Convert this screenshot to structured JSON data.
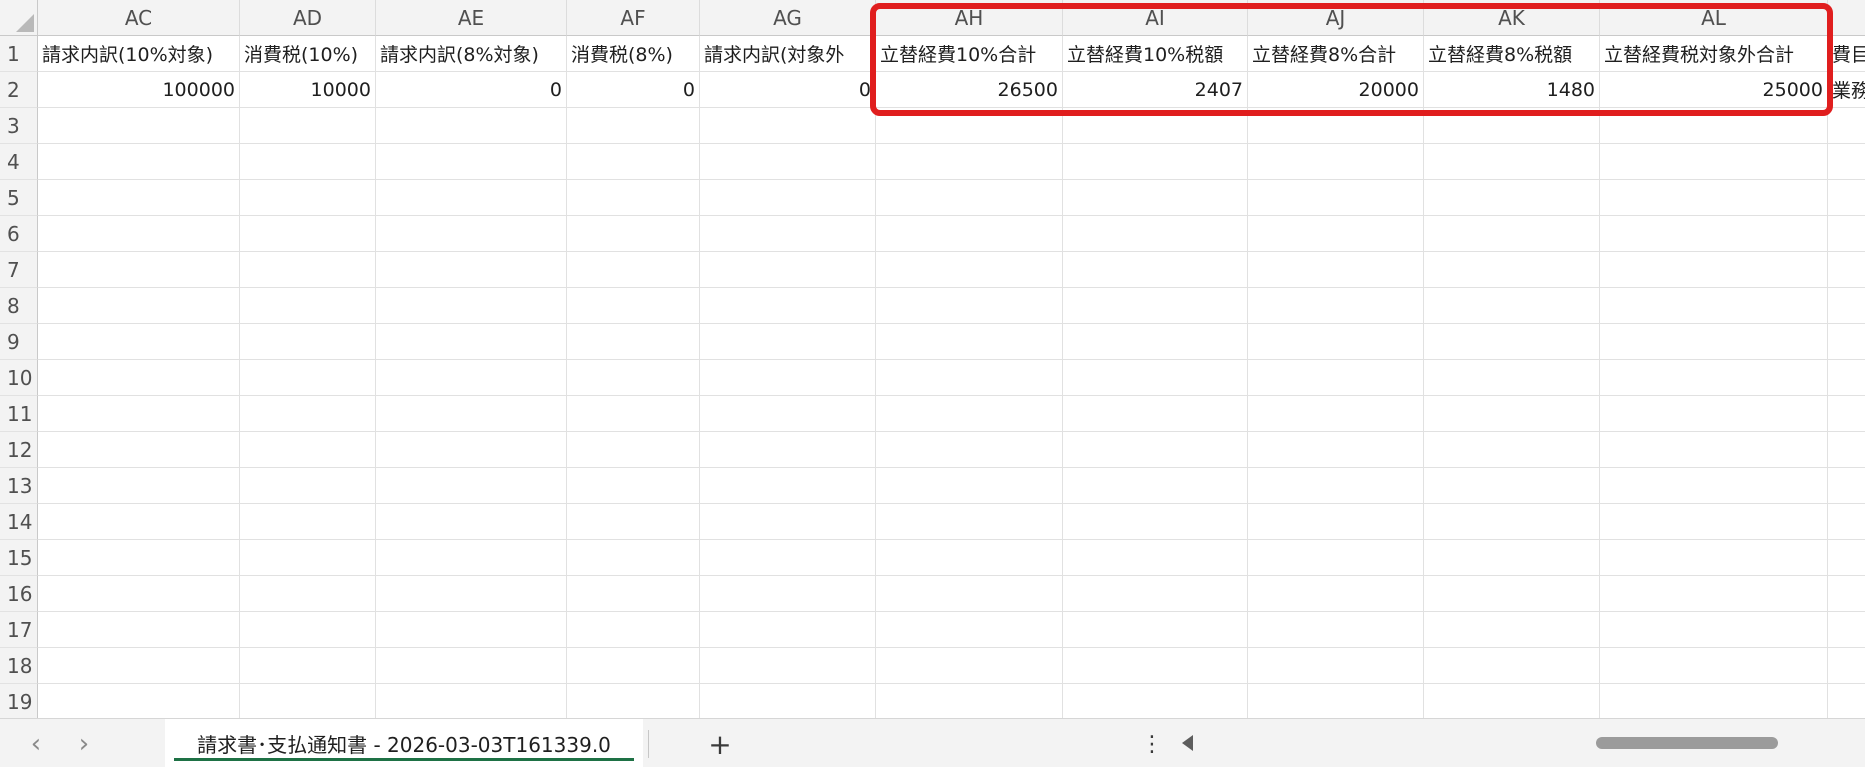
{
  "columns": [
    {
      "letter": "AC",
      "header": "請求内訳(10%対象)",
      "value": "100000",
      "value_type": "num"
    },
    {
      "letter": "AD",
      "header": "消費税(10%)",
      "value": "10000",
      "value_type": "num"
    },
    {
      "letter": "AE",
      "header": "請求内訳(8%対象)",
      "value": "0",
      "value_type": "num"
    },
    {
      "letter": "AF",
      "header": "消費税(8%)",
      "value": "0",
      "value_type": "num"
    },
    {
      "letter": "AG",
      "header": "請求内訳(対象外",
      "value": "0",
      "value_type": "num"
    },
    {
      "letter": "AH",
      "header": "立替経費10%合計",
      "value": "26500",
      "value_type": "num"
    },
    {
      "letter": "AI",
      "header": "立替経費10%税額",
      "value": "2407",
      "value_type": "num"
    },
    {
      "letter": "AJ",
      "header": "立替経費8%合計",
      "value": "20000",
      "value_type": "num"
    },
    {
      "letter": "AK",
      "header": "立替経費8%税額",
      "value": "1480",
      "value_type": "num"
    },
    {
      "letter": "AL",
      "header": "立替経費税対象外合計",
      "value": "25000",
      "value_type": "num"
    },
    {
      "letter": "",
      "header": "費目",
      "value": "業務",
      "value_type": "txt"
    }
  ],
  "rows": [
    "1",
    "2",
    "3",
    "4",
    "5",
    "6",
    "7",
    "8",
    "9",
    "10",
    "11",
    "12",
    "13",
    "14",
    "15",
    "16",
    "17",
    "18",
    "19"
  ],
  "tabbar": {
    "prev_icon": "‹",
    "next_icon": "›",
    "sheet_name": "請求書･支払通知書 - 2026-03-03T161339.0",
    "add_icon": "+",
    "more_icon": "⋮"
  },
  "colors": {
    "highlight": "#e01e1e",
    "active_tab_underline": "#1e7145"
  }
}
